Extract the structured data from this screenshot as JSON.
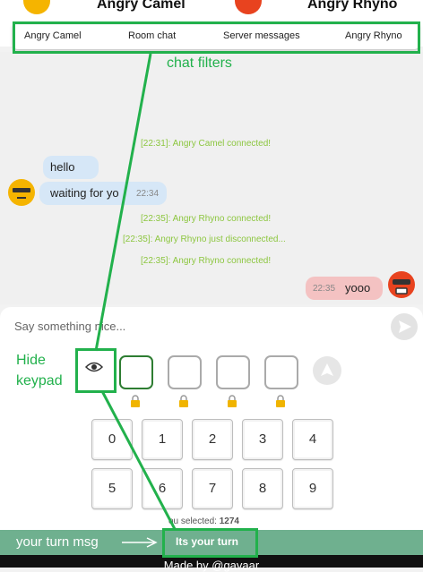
{
  "header": {
    "player1": {
      "name": "Angry Camel",
      "face_color": "#f5b400"
    },
    "player2": {
      "name": "Angry Rhyno",
      "face_color": "#e8431f"
    }
  },
  "filters": [
    "Angry Camel",
    "Room chat",
    "Server messages",
    "Angry Rhyno"
  ],
  "chat": {
    "system_messages": [
      "[22:31]: Angry Camel connected!",
      "[22:35]: Angry Rhyno connected!",
      "[22:35]: Angry Rhyno just disconnected...",
      "[22:35]: Angry Rhyno connected!"
    ],
    "incoming": [
      {
        "text": "hello",
        "time": ""
      },
      {
        "text": "waiting for yo",
        "time": "22:34"
      }
    ],
    "outgoing": {
      "text": "yooo",
      "time": "22:35"
    }
  },
  "input": {
    "placeholder": "Say something nice..."
  },
  "keypad": {
    "keys": [
      "0",
      "1",
      "2",
      "3",
      "4",
      "5",
      "6",
      "7",
      "8",
      "9"
    ],
    "selected_label": "ou selected:",
    "selected_value": "1274"
  },
  "turn": {
    "message": "Its your turn"
  },
  "footer": {
    "text": "Made by @gavaar"
  },
  "annotations": {
    "chat_filters": "chat filters",
    "hide_keypad_1": "Hide",
    "hide_keypad_2": "keypad",
    "your_turn_msg": "your turn msg"
  },
  "colors": {
    "annotation_green": "#22b14c",
    "system_message": "#8cc63f",
    "turn_bar": "#6fb08f",
    "incoming_bubble": "#d6e7f7",
    "outgoing_bubble": "#f4c2c2"
  }
}
